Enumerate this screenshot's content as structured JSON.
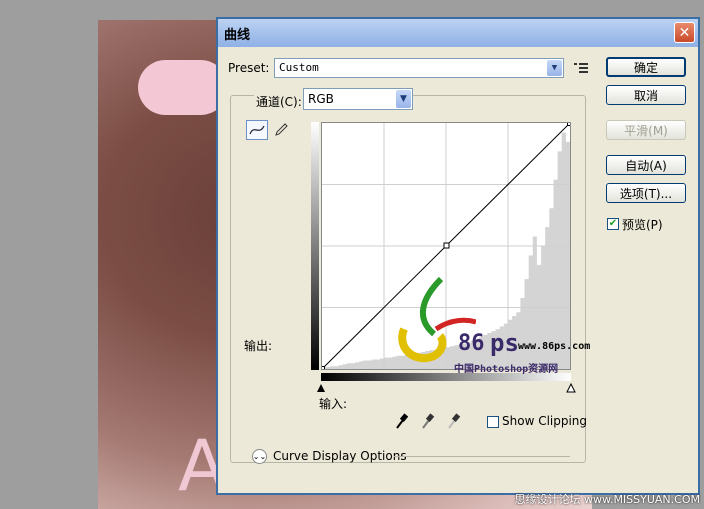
{
  "dialog": {
    "title": "曲线",
    "close_symbol": "✕",
    "preset_label": "Preset:",
    "preset_value": "Custom",
    "preset_menu_icon": "list-menu-icon",
    "channel_label": "通道(C):",
    "channel_value": "RGB",
    "output_label": "输出:",
    "input_label": "输入:",
    "show_clipping_label": "Show Clipping",
    "curve_display_options_label": "Curve Display Options",
    "buttons": {
      "ok": "确定",
      "cancel": "取消",
      "smooth": "平滑(M)",
      "auto": "自动(A)",
      "options": "选项(T)..."
    },
    "preview_label": "预览(P)",
    "preview_checked": true,
    "show_clipping_checked": false
  },
  "curve": {
    "points": [
      [
        0,
        0
      ],
      [
        128,
        128
      ],
      [
        255,
        255
      ]
    ],
    "histogram": [
      2,
      2,
      3,
      3,
      4,
      5,
      6,
      6,
      7,
      8,
      9,
      9,
      10,
      10,
      11,
      12,
      12,
      13,
      14,
      14,
      15,
      16,
      16,
      17,
      18,
      19,
      20,
      20,
      21,
      22,
      23,
      24,
      25,
      26,
      27,
      28,
      30,
      32,
      34,
      36,
      38,
      40,
      42,
      45,
      48,
      52,
      56,
      60,
      75,
      95,
      120,
      140,
      110,
      130,
      150,
      170,
      200,
      230,
      250,
      240
    ]
  },
  "watermark": {
    "brand_number": "86",
    "brand_letters": "ps",
    "url": "www.86ps.com",
    "tagline": "中国Photoshop资源网"
  },
  "site_credit": "思缘设计论坛 www.MISSYUAN.COM",
  "photo_overlay_letter": "A"
}
